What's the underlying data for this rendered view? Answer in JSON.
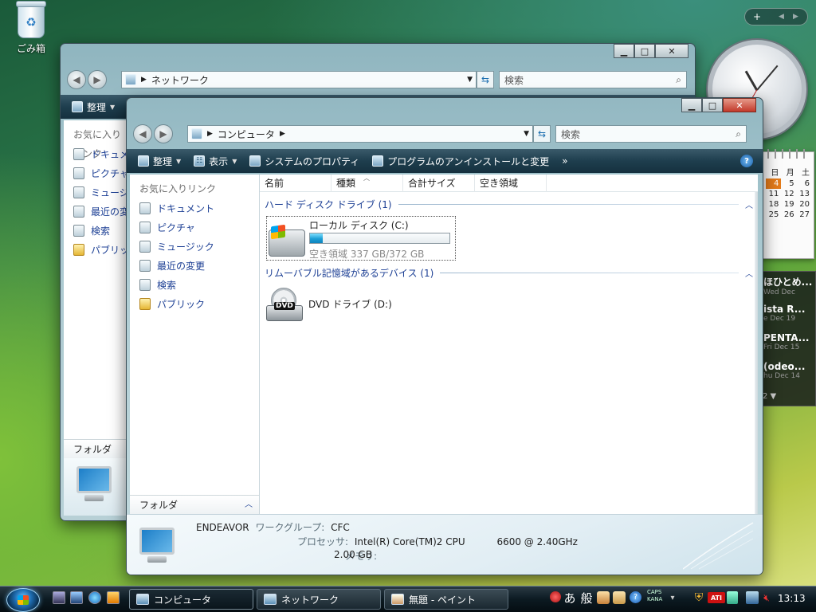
{
  "desktop": {
    "recycle_bin_label": "ごみ箱"
  },
  "gadgets": {
    "sidebar_controls": [
      "+",
      "◀",
      "▶"
    ],
    "calendar_days": [
      "日",
      "月",
      "土",
      "4",
      "5",
      "6",
      "11",
      "12",
      "13",
      "18",
      "19",
      "20",
      "25",
      "26",
      "27"
    ],
    "calendar_today": "4",
    "feed_items": [
      {
        "title": "ほひとめ...",
        "date": "Wed Dec"
      },
      {
        "title": "ista R...",
        "date": "e Dec 19"
      },
      {
        "title": "PENTA...",
        "date": "Fri Dec 15"
      },
      {
        "title": "(odeo...",
        "date": "hu Dec 14"
      }
    ]
  },
  "network_window": {
    "address": "ネットワーク",
    "search_placeholder": "検索",
    "toolbar_organize": "整理",
    "favorites_header": "お気に入りリンク",
    "nav_items": [
      "ドキュメント",
      "ピクチャ",
      "ミュージック",
      "最近の変更",
      "検索",
      "パブリック"
    ],
    "folder_label": "フォルダ"
  },
  "computer_window": {
    "address": "コンピュータ",
    "search_placeholder": "検索",
    "toolbar": {
      "organize": "整理",
      "view": "表示",
      "system_properties": "システムのプロパティ",
      "uninstall": "プログラムのアンインストールと変更",
      "more": "»",
      "help": "?"
    },
    "favorites_header": "お気に入りリンク",
    "nav_items": [
      "ドキュメント",
      "ピクチャ",
      "ミュージック",
      "最近の変更",
      "検索",
      "パブリック"
    ],
    "folder_label": "フォルダ",
    "columns": [
      "名前",
      "種類",
      "合計サイズ",
      "空き領域"
    ],
    "groups": [
      {
        "title": "ハード ディスク ドライブ (1)"
      },
      {
        "title": "リムーバブル記憶域があるデバイス (1)"
      }
    ],
    "local_disk": {
      "name": "ローカル ディスク (C:)",
      "free_text": "空き領域 337 GB/372 GB",
      "used_fraction": 0.094
    },
    "dvd_drive": {
      "name": "DVD ドライブ (D:)",
      "badge": "DVD"
    },
    "details": {
      "computer_name": "ENDEAVOR",
      "workgroup_label": "ワークグループ:",
      "workgroup_value": "CFC",
      "processor_label": "プロセッサ:",
      "processor_value": "Intel(R) Core(TM)2 CPU",
      "processor_speed": "6600  @ 2.40GHz",
      "memory_label": "メモリ:",
      "memory_value": "2.00 GB"
    }
  },
  "taskbar": {
    "tasks": [
      {
        "label": "コンピュータ",
        "active": true
      },
      {
        "label": "ネットワーク",
        "active": false
      },
      {
        "label": "無題 - ペイント",
        "active": false
      }
    ],
    "ime_mode": "あ",
    "ime_conversion": "般",
    "caps": "CAPS",
    "kana": "KANA",
    "clock": "13:13"
  }
}
